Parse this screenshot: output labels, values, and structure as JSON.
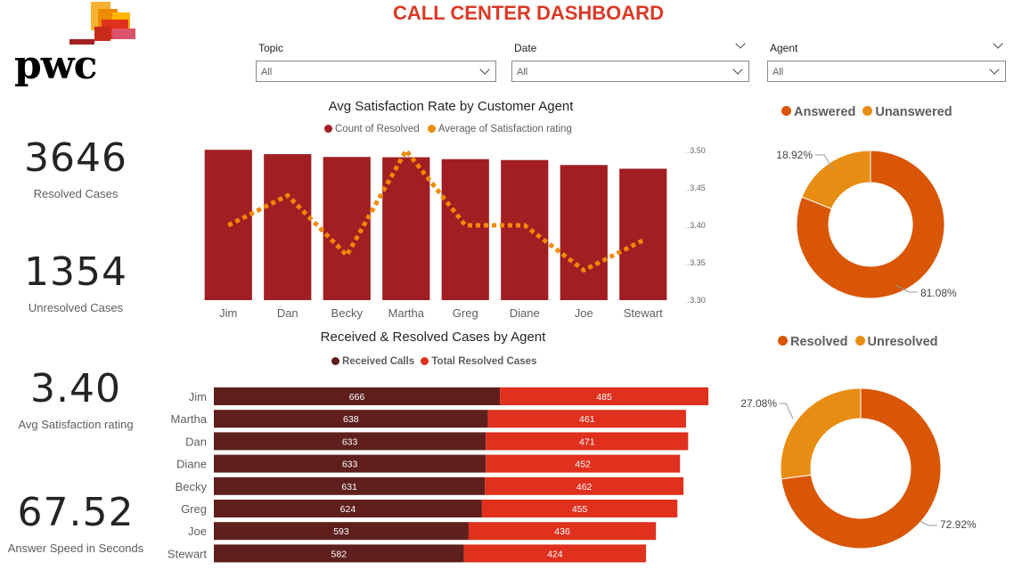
{
  "header": {
    "title": "CALL CENTER DASHBOARD",
    "logo_text": "pwc"
  },
  "filters": [
    {
      "label": "Topic",
      "value": "All"
    },
    {
      "label": "Date",
      "value": "All"
    },
    {
      "label": "Agent",
      "value": "All"
    }
  ],
  "kpis": [
    {
      "value": "3646",
      "label": "Resolved Cases"
    },
    {
      "value": "1354",
      "label": "Unresolved Cases"
    },
    {
      "value": "3.40",
      "label": "Avg Satisfaction rating"
    },
    {
      "value": "67.52",
      "label": "Answer Speed in Seconds"
    }
  ],
  "colors": {
    "title": "#d93a26",
    "bar_dark_red": "#a11e22",
    "line_orange": "#ee8a06",
    "received": "#5e1f1d",
    "resolved": "#e0301e",
    "donut_main": "#d85604",
    "donut_minor": "#e88d14"
  },
  "chart_data": [
    {
      "type": "bar",
      "title": "Avg Satisfaction Rate by Customer Agent",
      "categories": [
        "Jim",
        "Dan",
        "Becky",
        "Martha",
        "Greg",
        "Diane",
        "Joe",
        "Stewart"
      ],
      "series": [
        {
          "name": "Count of Resolved",
          "values": [
            485,
            471,
            462,
            461,
            455,
            452,
            436,
            424
          ],
          "kind": "bar"
        },
        {
          "name": "Average of Satisfaction rating",
          "values": [
            3.4,
            3.44,
            3.36,
            3.5,
            3.4,
            3.4,
            3.34,
            3.38
          ],
          "kind": "line",
          "axis": "right"
        }
      ],
      "y_right_ticks": [
        "3.50",
        "3.45",
        "3.40",
        "3.35",
        "3.30"
      ],
      "y_right_range": [
        3.3,
        3.5
      ],
      "legend_position": "top"
    },
    {
      "type": "bar",
      "orientation": "horizontal-stacked",
      "title": "Received & Resolved Cases by Agent",
      "categories": [
        "Jim",
        "Martha",
        "Dan",
        "Diane",
        "Becky",
        "Greg",
        "Joe",
        "Stewart"
      ],
      "series": [
        {
          "name": "Received Calls",
          "values": [
            666,
            638,
            633,
            633,
            631,
            624,
            593,
            582
          ]
        },
        {
          "name": "Total Resolved Cases",
          "values": [
            485,
            461,
            471,
            452,
            462,
            455,
            436,
            424
          ]
        }
      ],
      "legend_position": "top"
    },
    {
      "type": "pie",
      "donut": true,
      "categories": [
        "Answered",
        "Unanswered"
      ],
      "values": [
        81.08,
        18.92
      ],
      "labels": [
        "81.08%",
        "18.92%"
      ]
    },
    {
      "type": "pie",
      "donut": true,
      "categories": [
        "Resolved",
        "Unresolved"
      ],
      "values": [
        72.92,
        27.08
      ],
      "labels": [
        "72.92%",
        "27.08%"
      ]
    }
  ]
}
